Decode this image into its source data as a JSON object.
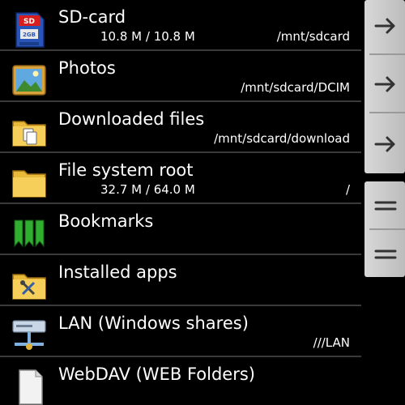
{
  "items": [
    {
      "title": "SD-card",
      "size": "10.8 M / 10.8 M",
      "path": "/mnt/sdcard",
      "icon": "sd-card-icon"
    },
    {
      "title": "Photos",
      "size": "",
      "path": "/mnt/sdcard/DCIM",
      "icon": "photos-icon"
    },
    {
      "title": "Downloaded files",
      "size": "",
      "path": "/mnt/sdcard/download",
      "icon": "download-folder-icon"
    },
    {
      "title": "File system root",
      "size": "32.7 M / 64.0 M",
      "path": "/",
      "icon": "folder-icon"
    },
    {
      "title": "Bookmarks",
      "size": "",
      "path": "",
      "icon": "bookmarks-icon"
    },
    {
      "title": "Installed apps",
      "size": "",
      "path": "",
      "icon": "installed-apps-icon"
    },
    {
      "title": "LAN (Windows shares)",
      "size": "",
      "path": "///LAN",
      "icon": "lan-icon"
    },
    {
      "title": "WebDAV (WEB Folders)",
      "size": "",
      "path": "",
      "icon": "webdav-icon"
    }
  ],
  "sidebar": {
    "arrow_buttons": [
      "arrow-right-icon",
      "arrow-right-icon",
      "arrow-right-icon"
    ],
    "drag_handles": [
      "drag-handle-icon",
      "drag-handle-icon"
    ]
  },
  "colors": {
    "background": "#000000",
    "divider": "#3a3a3a",
    "sidebar_button": "#cfcfcf"
  }
}
